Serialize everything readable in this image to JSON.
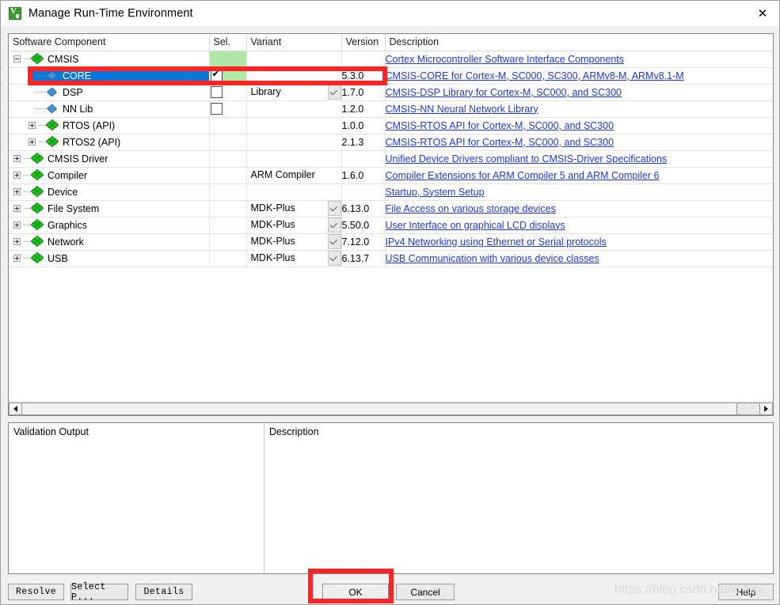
{
  "window": {
    "title": "Manage Run-Time Environment",
    "icon": "keil-uvision-icon",
    "close_label": "✕"
  },
  "table": {
    "headers": {
      "name": "Software Component",
      "sel": "Sel.",
      "variant": "Variant",
      "version": "Version",
      "description": "Description"
    },
    "rows": [
      {
        "name": "CMSIS",
        "level": 0,
        "expander": "minus",
        "icon": "green-diamond-cluster-icon",
        "sel": "green",
        "checkbox": "none",
        "variant": "",
        "variant_dropdown": false,
        "version": "",
        "description": "Cortex Microcontroller Software Interface Components",
        "selected": false
      },
      {
        "name": "CORE",
        "level": 1,
        "expander": "none",
        "icon": "blue-diamond-icon",
        "sel": "green",
        "checkbox": "checked",
        "variant": "",
        "variant_dropdown": false,
        "version": "5.3.0",
        "description": "CMSIS-CORE for Cortex-M, SC000, SC300, ARMv8-M, ARMv8.1-M",
        "selected": true
      },
      {
        "name": "DSP",
        "level": 1,
        "expander": "none",
        "icon": "blue-diamond-icon",
        "sel": "none",
        "checkbox": "unchecked",
        "variant": "Library",
        "variant_dropdown": true,
        "version": "1.7.0",
        "description": "CMSIS-DSP Library for Cortex-M, SC000, and SC300",
        "selected": false
      },
      {
        "name": "NN Lib",
        "level": 1,
        "expander": "none",
        "icon": "blue-diamond-icon",
        "sel": "none",
        "checkbox": "unchecked",
        "variant": "",
        "variant_dropdown": false,
        "version": "1.2.0",
        "description": "CMSIS-NN Neural Network Library",
        "selected": false
      },
      {
        "name": "RTOS (API)",
        "level": 1,
        "expander": "plus",
        "icon": "green-diamond-cluster-icon",
        "sel": "none",
        "checkbox": "none",
        "variant": "",
        "variant_dropdown": false,
        "version": "1.0.0",
        "description": "CMSIS-RTOS API for Cortex-M, SC000, and SC300",
        "selected": false
      },
      {
        "name": "RTOS2 (API)",
        "level": 1,
        "expander": "plus",
        "icon": "green-diamond-cluster-icon",
        "sel": "none",
        "checkbox": "none",
        "variant": "",
        "variant_dropdown": false,
        "version": "2.1.3",
        "description": "CMSIS-RTOS API for Cortex-M, SC000, and SC300",
        "selected": false
      },
      {
        "name": "CMSIS Driver",
        "level": 0,
        "expander": "plus",
        "icon": "green-diamond-cluster-icon",
        "sel": "none",
        "checkbox": "none",
        "variant": "",
        "variant_dropdown": false,
        "version": "",
        "description": "Unified Device Drivers compliant to CMSIS-Driver Specifications",
        "selected": false
      },
      {
        "name": "Compiler",
        "level": 0,
        "expander": "plus",
        "icon": "green-diamond-cluster-icon",
        "sel": "none",
        "checkbox": "none",
        "variant": "ARM Compiler",
        "variant_dropdown": false,
        "version": "1.6.0",
        "description": "Compiler Extensions for ARM Compiler 5 and ARM Compiler 6",
        "selected": false
      },
      {
        "name": "Device",
        "level": 0,
        "expander": "plus",
        "icon": "green-diamond-cluster-icon",
        "sel": "none",
        "checkbox": "none",
        "variant": "",
        "variant_dropdown": false,
        "version": "",
        "description": "Startup, System Setup",
        "selected": false
      },
      {
        "name": "File System",
        "level": 0,
        "expander": "plus",
        "icon": "green-diamond-cluster-icon",
        "sel": "none",
        "checkbox": "none",
        "variant": "MDK-Plus",
        "variant_dropdown": true,
        "version": "6.13.0",
        "description": "File Access on various storage devices",
        "selected": false
      },
      {
        "name": "Graphics",
        "level": 0,
        "expander": "plus",
        "icon": "green-diamond-cluster-icon",
        "sel": "none",
        "checkbox": "none",
        "variant": "MDK-Plus",
        "variant_dropdown": true,
        "version": "5.50.0",
        "description": "User Interface on graphical LCD displays",
        "selected": false
      },
      {
        "name": "Network",
        "level": 0,
        "expander": "plus",
        "icon": "green-diamond-cluster-icon",
        "sel": "none",
        "checkbox": "none",
        "variant": "MDK-Plus",
        "variant_dropdown": true,
        "version": "7.12.0",
        "description": "IPv4 Networking using Ethernet or Serial protocols",
        "selected": false
      },
      {
        "name": "USB",
        "level": 0,
        "expander": "plus",
        "icon": "green-diamond-cluster-icon",
        "sel": "none",
        "checkbox": "none",
        "variant": "MDK-Plus",
        "variant_dropdown": true,
        "version": "6.13.7",
        "description": "USB Communication with various device classes",
        "selected": false
      }
    ]
  },
  "panes": {
    "validation_output_title": "Validation Output",
    "validation_output_text": "",
    "description_title": "Description",
    "description_text": ""
  },
  "footer": {
    "resolve": "Resolve",
    "select_packs": "Select P...",
    "details": "Details",
    "ok": "OK",
    "cancel": "Cancel",
    "help": "Help"
  },
  "watermark": {
    "text": "https://blog.csdn.net/w       kay"
  },
  "colors": {
    "selection_blue": "#0c77d8",
    "sel_green": "#aee8a4",
    "link_blue": "#1c37e8",
    "annotation_red": "#fb2323",
    "icon_green": "#22c322",
    "icon_blue": "#4a8fd6"
  }
}
